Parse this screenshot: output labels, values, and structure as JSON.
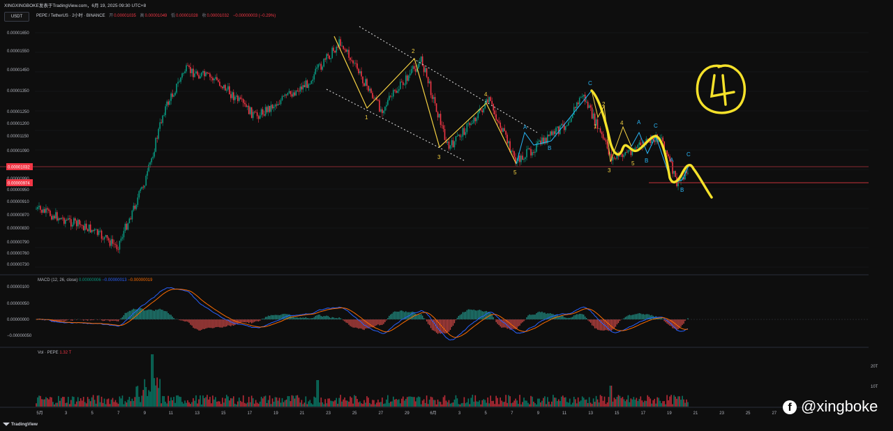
{
  "topbar": {
    "text": "XINGXINGBOKE发表于TradingView.com，6月 19, 2025 09:30 UTC+8"
  },
  "currency_button": "USDT",
  "symbol": {
    "name": "PEPE / TetherUS · 2小时 · BINANCE",
    "open_label": "开",
    "open": "0.00001035",
    "high_label": "高",
    "high": "0.00001049",
    "low_label": "低",
    "low": "0.00001028",
    "close_label": "收",
    "close": "0.00001032",
    "change": "−0.00000003 (−0.29%)"
  },
  "price_axis": {
    "ticks": [
      "0.00001650",
      "0.00001550",
      "0.00001450",
      "0.00001350",
      "0.00001250",
      "0.00001200",
      "0.00001150",
      "0.00001090",
      "0.00000990",
      "0.00000950",
      "0.00000910",
      "0.00000870",
      "0.00000830",
      "0.00000790",
      "0.00000760",
      "0.00000730"
    ],
    "current_price": "0.00001032",
    "marked_price": "0.00000974"
  },
  "macd": {
    "label": "MACD (12, 26, close)",
    "macd_value": "0.00000006",
    "signal_value": "−0.00000013",
    "hist_value": "−0.00000019",
    "ticks": [
      "0.00000100",
      "0.00000050",
      "0.00000000",
      "−0.00000050"
    ]
  },
  "volume": {
    "label": "Vol · PEPE",
    "value": "1.32 T",
    "ticks": [
      "20T",
      "10T"
    ]
  },
  "time_axis": [
    "5月",
    "3",
    "5",
    "7",
    "9",
    "11",
    "13",
    "15",
    "17",
    "19",
    "21",
    "23",
    "25",
    "27",
    "29",
    "6月",
    "3",
    "5",
    "7",
    "9",
    "11",
    "13",
    "15",
    "17",
    "19",
    "21",
    "23",
    "25",
    "27"
  ],
  "wave_labels": {
    "yellow": [
      "2",
      "1",
      "3",
      "4",
      "3",
      "5",
      "2",
      "1",
      "4",
      "3",
      "5"
    ],
    "cyan": [
      "C",
      "B",
      "A",
      "A",
      "B",
      "C",
      "A",
      "B",
      "C"
    ]
  },
  "annotation_circle": "4",
  "footer": {
    "brand": "TradingView"
  },
  "watermark": {
    "handle": "@xingboke"
  },
  "chart_data": {
    "type": "candlestick",
    "symbol": "PEPE / TetherUS",
    "timeframe": "2小时",
    "approx_close_path": [
      {
        "x": "5月1",
        "y": 8.9e-06
      },
      {
        "x": "5月5",
        "y": 8.3e-06
      },
      {
        "x": "5月7",
        "y": 7.8e-06
      },
      {
        "x": "5月9",
        "y": 1e-05
      },
      {
        "x": "5月10",
        "y": 1.25e-05
      },
      {
        "x": "5月12",
        "y": 1.45e-05
      },
      {
        "x": "5月14",
        "y": 1.4e-05
      },
      {
        "x": "5月17",
        "y": 1.23e-05
      },
      {
        "x": "5月21",
        "y": 1.38e-05
      },
      {
        "x": "5月23",
        "y": 1.6e-05
      },
      {
        "x": "5月26",
        "y": 1.26e-05
      },
      {
        "x": "5月29",
        "y": 1.5e-05
      },
      {
        "x": "6月1",
        "y": 1.1e-05
      },
      {
        "x": "6月4",
        "y": 1.3e-05
      },
      {
        "x": "6月6",
        "y": 1.05e-05
      },
      {
        "x": "6月10",
        "y": 1.2e-05
      },
      {
        "x": "6月11",
        "y": 1.33e-05
      },
      {
        "x": "6月13",
        "y": 1.06e-05
      },
      {
        "x": "6月17",
        "y": 1.15e-05
      },
      {
        "x": "6月18",
        "y": 9.7e-06
      },
      {
        "x": "6月19",
        "y": 1.03e-05
      }
    ]
  },
  "colors": {
    "up": "#089981",
    "down": "#f23645",
    "wave": "#f5d142",
    "wave_label_cyan": "#29b6f6",
    "macd": "#2962ff",
    "signal": "#ff6d00"
  }
}
